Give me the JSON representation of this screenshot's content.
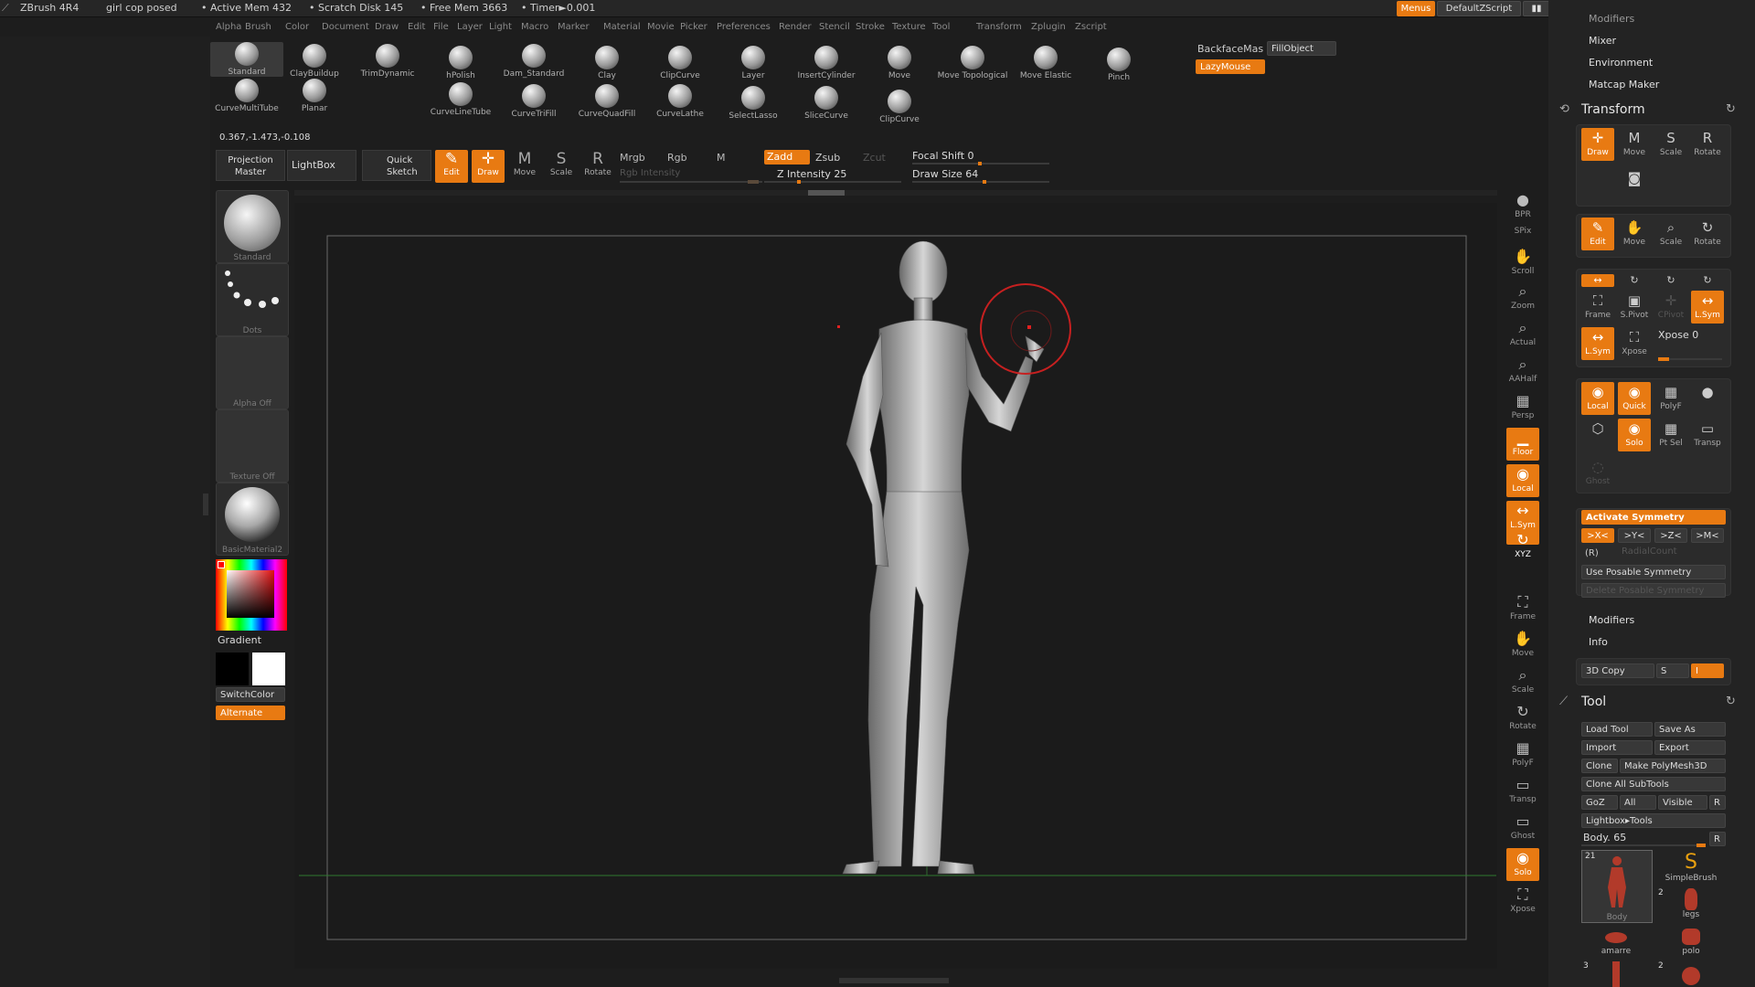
{
  "titlebar": {
    "app": "ZBrush 4R4",
    "document": "girl cop posed",
    "active_mem": "• Active Mem 432",
    "scratch": "• Scratch Disk 145",
    "free_mem": "• Free Mem 3663",
    "timer": "• Timer►0.001",
    "menus_btn": "Menus",
    "script_btn": "DefaultZScript"
  },
  "menubar": [
    "Alpha",
    "Brush",
    "Color",
    "Document",
    "Draw",
    "Edit",
    "File",
    "Layer",
    "Light",
    "Macro",
    "Marker",
    "Material",
    "Movie",
    "Picker",
    "Preferences",
    "Render",
    "Stencil",
    "Stroke",
    "Texture",
    "Tool",
    "Transform",
    "Zplugin",
    "Zscript"
  ],
  "brushes": [
    {
      "name": "Standard"
    },
    {
      "name": "ClayBuildup"
    },
    {
      "name": "TrimDynamic"
    },
    {
      "name": "hPolish"
    },
    {
      "name": "Dam_Standard"
    },
    {
      "name": "Clay"
    },
    {
      "name": "ClipCurve"
    },
    {
      "name": "Layer"
    },
    {
      "name": "InsertCylinder"
    },
    {
      "name": "Move"
    },
    {
      "name": "Move Topological"
    },
    {
      "name": "Move Elastic"
    },
    {
      "name": "Pinch"
    },
    {
      "name": "CurveMultiTube"
    },
    {
      "name": "Planar"
    },
    {
      "name": "CurveLineTube"
    },
    {
      "name": "CurveTriFill"
    },
    {
      "name": "CurveQuadFill"
    },
    {
      "name": "CurveLathe"
    },
    {
      "name": "SelectLasso"
    },
    {
      "name": "SliceCurve"
    },
    {
      "name": "ClipCurve"
    }
  ],
  "top_right": {
    "backface": "BackfaceMas",
    "fillobject": "FillObject",
    "lazymouse": "LazyMouse"
  },
  "coords": "0.367,-1.473,-0.108",
  "toolbar": {
    "projection_master": "Projection Master",
    "lightbox": "LightBox",
    "quick_sketch": "Quick Sketch",
    "edit": "Edit",
    "draw": "Draw",
    "move": "Move",
    "scale": "Scale",
    "rotate": "Rotate",
    "mrgb": "Mrgb",
    "rgb": "Rgb",
    "m": "M",
    "zadd": "Zadd",
    "zsub": "Zsub",
    "zcut": "Zcut",
    "rgb_intensity": "Rgb Intensity",
    "z_intensity": "Z Intensity 25",
    "focal_shift": "Focal Shift 0",
    "draw_size": "Draw Size 64",
    "z_intensity_value": 25,
    "draw_size_value": 64
  },
  "leftpanel": {
    "brush": "Standard",
    "stroke": "Dots",
    "alpha": "Alpha Off",
    "texture": "Texture Off",
    "material": "BasicMaterial2",
    "gradient": "Gradient",
    "switchcolor": "SwitchColor",
    "alternate": "Alternate"
  },
  "rightshelf": [
    "BPR",
    "SPix",
    "Scroll",
    "Zoom",
    "Actual",
    "AAHalf",
    "Persp",
    "Floor",
    "Local",
    "L.Sym",
    "XYZ",
    "Frame",
    "Move",
    "Scale",
    "Rotate",
    "PolyF",
    "Transp",
    "Ghost",
    "Solo",
    "Xpose"
  ],
  "rpanel": {
    "top_items": [
      "Modifiers",
      "Mixer",
      "Environment",
      "Matcap Maker"
    ],
    "transform_title": "Transform",
    "transform_row1": [
      "Draw",
      "Move",
      "Scale",
      "Rotate"
    ],
    "transform_row2": [
      "Edit",
      "Move",
      "Scale",
      "Rotate"
    ],
    "transform_row3": [
      "Frame",
      "S.Pivot",
      "CPivot",
      "L.Sym"
    ],
    "transform_row4": [
      "L.Sym",
      "Xpose",
      "Xpose 0"
    ],
    "transform_row5": [
      "Local",
      "Quick",
      "PolyF",
      ""
    ],
    "transform_row6": [
      "",
      "Solo",
      "Pt Sel",
      "Transp"
    ],
    "ghost": "Ghost",
    "activate_symmetry": "Activate Symmetry",
    "sym_axes": [
      ">X<",
      ">Y<",
      ">Z<",
      ">M<"
    ],
    "r": "(R)",
    "radial_count": "RadialCount",
    "use_posable": "Use Posable Symmetry",
    "delete_posable": "Delete Posable Symmetry",
    "modifiers": "Modifiers",
    "info": "Info",
    "copy3d": "3D Copy",
    "copy_s": "S",
    "copy_i": "I",
    "tool_title": "Tool",
    "load_tool": "Load Tool",
    "save_as": "Save As",
    "import": "Import",
    "export": "Export",
    "clone": "Clone",
    "make_polymesh": "Make PolyMesh3D",
    "clone_all": "Clone All SubTools",
    "goz": "GoZ",
    "all": "All",
    "visible": "Visible",
    "r_btn": "R",
    "lightbox_tools": "Lightbox▸Tools",
    "body_label": "Body. 65",
    "body_r": "R",
    "thumbs": [
      {
        "name": "Body",
        "count": "21"
      },
      {
        "name": "SimpleBrush",
        "count": ""
      },
      {
        "name": "legs",
        "count": "2"
      },
      {
        "name": "amarre",
        "count": ""
      },
      {
        "name": "polo",
        "count": ""
      },
      {
        "name": "",
        "count": "3"
      },
      {
        "name": "",
        "count": "2"
      }
    ]
  }
}
